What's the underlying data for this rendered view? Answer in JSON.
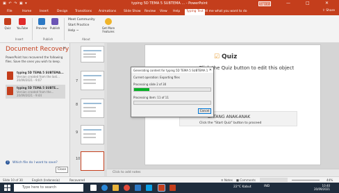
{
  "titlebar": {
    "quick_access": "▣ ↶ ↷ ▣ ▾",
    "title": "typing 5D TEMA 5 SUBTEMA ... - PowerPoint",
    "sign_in": "Sign in",
    "min": "—",
    "max": "□",
    "close": "✕"
  },
  "tabs": [
    "File",
    "Home",
    "Insert",
    "Design",
    "Transitions",
    "Animations",
    "Slide Show",
    "Review",
    "View",
    "Help",
    "Typing Test"
  ],
  "active_tab": "Typing Test",
  "tellme": "⌕ Tell me what you want to do",
  "share": "⇧ Share",
  "ribbon": {
    "buttons": [
      {
        "label": "Quiz",
        "color": "#c43e1c"
      },
      {
        "label": "YouTube",
        "color": "#e02a2a"
      },
      {
        "label": "Preview",
        "color": "#2b78c4"
      },
      {
        "label": "Publish",
        "color": "#6b54b5"
      }
    ],
    "group_insert": "Insert",
    "group_publish": "Publish",
    "meet": "Meet Community",
    "start": "Start Practice",
    "help": "Help ~",
    "get_more": "Get More Features",
    "group_about": "About"
  },
  "recovery": {
    "title": "Document Recovery",
    "close": "✕",
    "desc": "PowerPoint has recovered the following files. Save the ones you wish to keep.",
    "items": [
      {
        "name": "typing 5D TEMA 5 SUBTEMA...",
        "l2": "Version created from the last...",
        "l3": "20/09/2021 - 9:07"
      },
      {
        "name": "typing 5D TEMA 5 SUBTE...",
        "l2": "Version created from the...",
        "l3": "20/09/2021 - 9:44"
      }
    ],
    "help_icon": "?",
    "link": "Which file do I want to save?",
    "close_btn": "Close"
  },
  "thumbs": {
    "nums": [
      "6",
      "7",
      "8",
      "9",
      "10"
    ]
  },
  "slide": {
    "logo_icon": "☑",
    "logo": "Quiz",
    "hint": "Click the Quiz button to edit this object",
    "caption": "DATANG ANAK-ANAK",
    "caption2": "Click the \"Start Quiz\" button to proceed"
  },
  "notes": "Click to add notes",
  "dialog": {
    "title": "Generating content for typing 5D TEMA 5 SUBTEMA 1",
    "close": "✕",
    "op": "Current operation:   Exporting files",
    "p1": "Processing slide 2 of 30",
    "p2": "Processing item: 11 of 11",
    "cancel": "Cancel",
    "progress1": 0.2,
    "progress2": 0.0
  },
  "status": {
    "slide": "Slide 10 of 30",
    "lang": "English (Indonesia)",
    "note": "Recovered",
    "notes_btn": "≡ Notes",
    "comments": "■ Comments",
    "zoom": "44%"
  },
  "taskbar": {
    "search": "Type here to search",
    "weather": "22°C Kabut",
    "lang": "IND",
    "time": "10:40",
    "date": "20/09/2021"
  }
}
